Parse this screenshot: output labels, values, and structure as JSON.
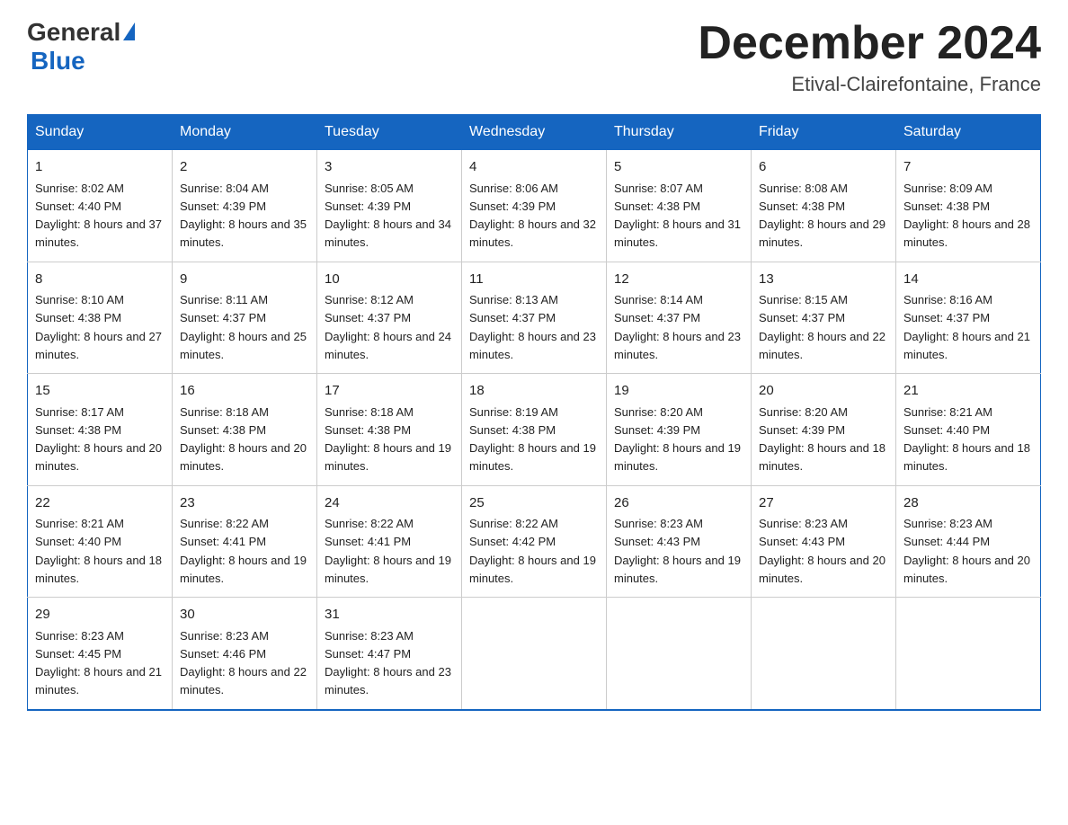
{
  "header": {
    "logo_general": "General",
    "logo_blue": "Blue",
    "month_title": "December 2024",
    "location": "Etival-Clairefontaine, France"
  },
  "weekdays": [
    "Sunday",
    "Monday",
    "Tuesday",
    "Wednesday",
    "Thursday",
    "Friday",
    "Saturday"
  ],
  "weeks": [
    [
      {
        "day": "1",
        "sunrise": "8:02 AM",
        "sunset": "4:40 PM",
        "daylight": "8 hours and 37 minutes."
      },
      {
        "day": "2",
        "sunrise": "8:04 AM",
        "sunset": "4:39 PM",
        "daylight": "8 hours and 35 minutes."
      },
      {
        "day": "3",
        "sunrise": "8:05 AM",
        "sunset": "4:39 PM",
        "daylight": "8 hours and 34 minutes."
      },
      {
        "day": "4",
        "sunrise": "8:06 AM",
        "sunset": "4:39 PM",
        "daylight": "8 hours and 32 minutes."
      },
      {
        "day": "5",
        "sunrise": "8:07 AM",
        "sunset": "4:38 PM",
        "daylight": "8 hours and 31 minutes."
      },
      {
        "day": "6",
        "sunrise": "8:08 AM",
        "sunset": "4:38 PM",
        "daylight": "8 hours and 29 minutes."
      },
      {
        "day": "7",
        "sunrise": "8:09 AM",
        "sunset": "4:38 PM",
        "daylight": "8 hours and 28 minutes."
      }
    ],
    [
      {
        "day": "8",
        "sunrise": "8:10 AM",
        "sunset": "4:38 PM",
        "daylight": "8 hours and 27 minutes."
      },
      {
        "day": "9",
        "sunrise": "8:11 AM",
        "sunset": "4:37 PM",
        "daylight": "8 hours and 25 minutes."
      },
      {
        "day": "10",
        "sunrise": "8:12 AM",
        "sunset": "4:37 PM",
        "daylight": "8 hours and 24 minutes."
      },
      {
        "day": "11",
        "sunrise": "8:13 AM",
        "sunset": "4:37 PM",
        "daylight": "8 hours and 23 minutes."
      },
      {
        "day": "12",
        "sunrise": "8:14 AM",
        "sunset": "4:37 PM",
        "daylight": "8 hours and 23 minutes."
      },
      {
        "day": "13",
        "sunrise": "8:15 AM",
        "sunset": "4:37 PM",
        "daylight": "8 hours and 22 minutes."
      },
      {
        "day": "14",
        "sunrise": "8:16 AM",
        "sunset": "4:37 PM",
        "daylight": "8 hours and 21 minutes."
      }
    ],
    [
      {
        "day": "15",
        "sunrise": "8:17 AM",
        "sunset": "4:38 PM",
        "daylight": "8 hours and 20 minutes."
      },
      {
        "day": "16",
        "sunrise": "8:18 AM",
        "sunset": "4:38 PM",
        "daylight": "8 hours and 20 minutes."
      },
      {
        "day": "17",
        "sunrise": "8:18 AM",
        "sunset": "4:38 PM",
        "daylight": "8 hours and 19 minutes."
      },
      {
        "day": "18",
        "sunrise": "8:19 AM",
        "sunset": "4:38 PM",
        "daylight": "8 hours and 19 minutes."
      },
      {
        "day": "19",
        "sunrise": "8:20 AM",
        "sunset": "4:39 PM",
        "daylight": "8 hours and 19 minutes."
      },
      {
        "day": "20",
        "sunrise": "8:20 AM",
        "sunset": "4:39 PM",
        "daylight": "8 hours and 18 minutes."
      },
      {
        "day": "21",
        "sunrise": "8:21 AM",
        "sunset": "4:40 PM",
        "daylight": "8 hours and 18 minutes."
      }
    ],
    [
      {
        "day": "22",
        "sunrise": "8:21 AM",
        "sunset": "4:40 PM",
        "daylight": "8 hours and 18 minutes."
      },
      {
        "day": "23",
        "sunrise": "8:22 AM",
        "sunset": "4:41 PM",
        "daylight": "8 hours and 19 minutes."
      },
      {
        "day": "24",
        "sunrise": "8:22 AM",
        "sunset": "4:41 PM",
        "daylight": "8 hours and 19 minutes."
      },
      {
        "day": "25",
        "sunrise": "8:22 AM",
        "sunset": "4:42 PM",
        "daylight": "8 hours and 19 minutes."
      },
      {
        "day": "26",
        "sunrise": "8:23 AM",
        "sunset": "4:43 PM",
        "daylight": "8 hours and 19 minutes."
      },
      {
        "day": "27",
        "sunrise": "8:23 AM",
        "sunset": "4:43 PM",
        "daylight": "8 hours and 20 minutes."
      },
      {
        "day": "28",
        "sunrise": "8:23 AM",
        "sunset": "4:44 PM",
        "daylight": "8 hours and 20 minutes."
      }
    ],
    [
      {
        "day": "29",
        "sunrise": "8:23 AM",
        "sunset": "4:45 PM",
        "daylight": "8 hours and 21 minutes."
      },
      {
        "day": "30",
        "sunrise": "8:23 AM",
        "sunset": "4:46 PM",
        "daylight": "8 hours and 22 minutes."
      },
      {
        "day": "31",
        "sunrise": "8:23 AM",
        "sunset": "4:47 PM",
        "daylight": "8 hours and 23 minutes."
      },
      null,
      null,
      null,
      null
    ]
  ]
}
